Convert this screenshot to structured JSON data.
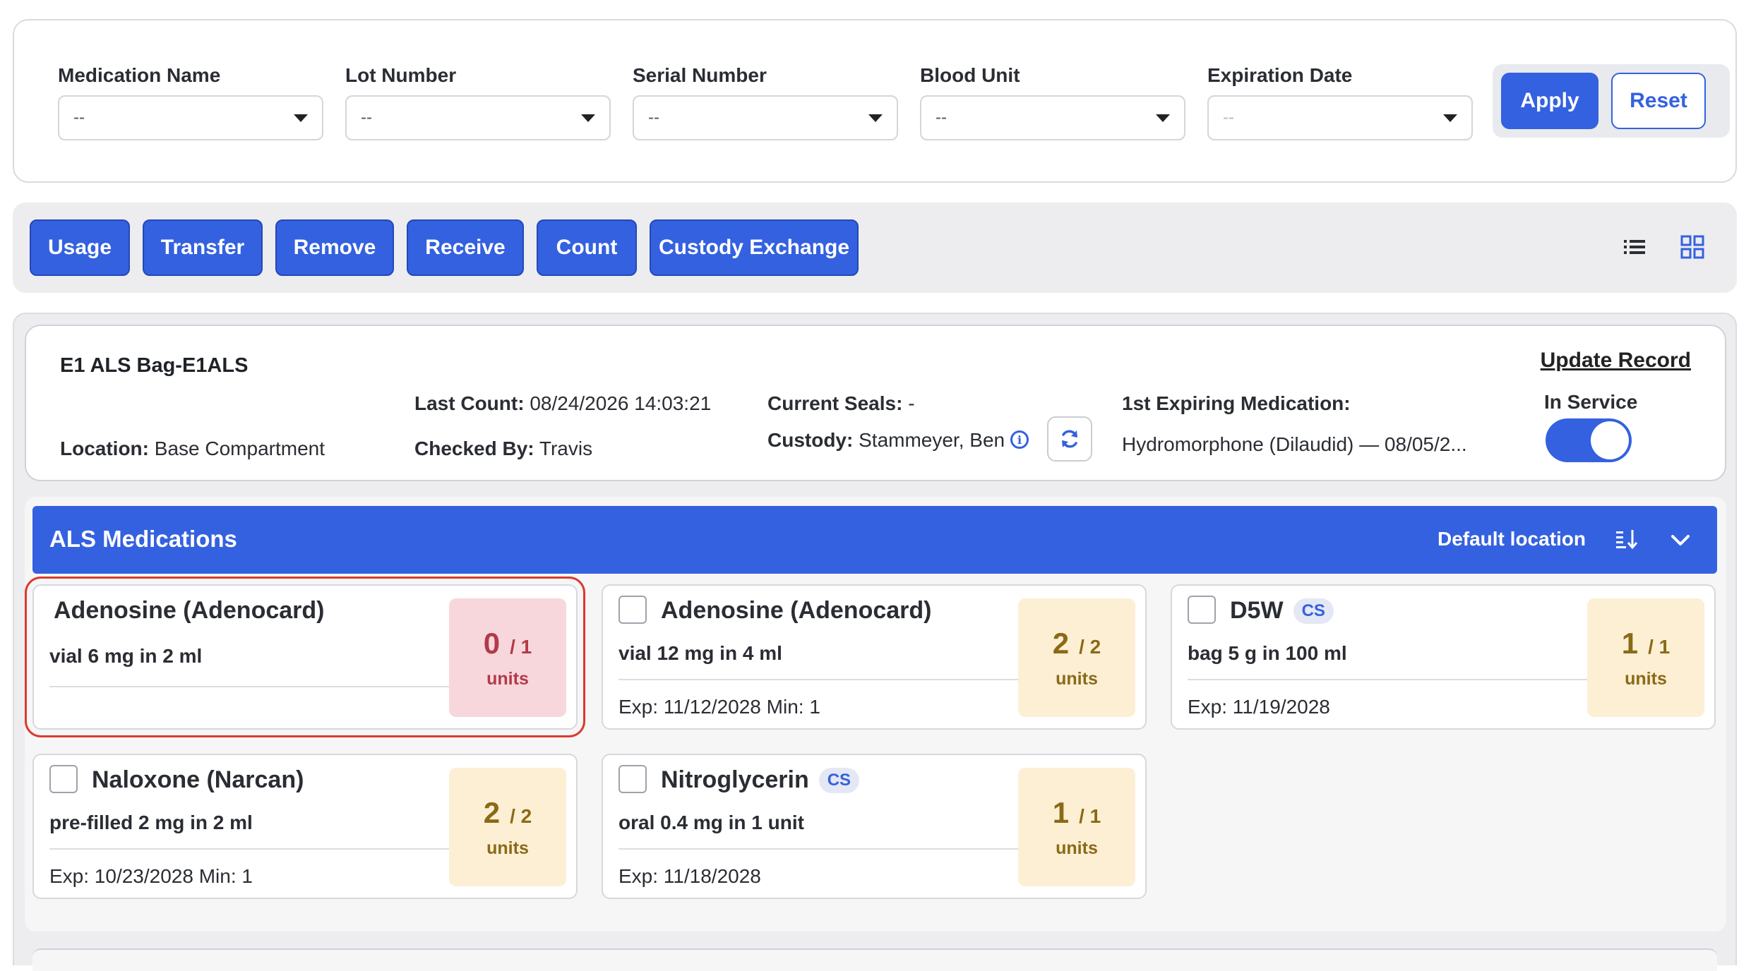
{
  "filters": [
    {
      "label": "Medication Name",
      "value": "--"
    },
    {
      "label": "Lot Number",
      "value": "--"
    },
    {
      "label": "Serial Number",
      "value": "--"
    },
    {
      "label": "Blood Unit",
      "value": "--"
    },
    {
      "label": "Expiration Date",
      "value": "--"
    }
  ],
  "filter_buttons": {
    "apply": "Apply",
    "reset": "Reset"
  },
  "actions": [
    "Usage",
    "Transfer",
    "Remove",
    "Receive",
    "Count",
    "Custody Exchange"
  ],
  "bag": {
    "title": "E1 ALS Bag-E1ALS",
    "location_label": "Location:",
    "location": "Base Compartment",
    "last_count_label": "Last Count:",
    "last_count": "08/24/2026 14:03:21",
    "checked_by_label": "Checked By:",
    "checked_by": "Travis",
    "seals_label": "Current Seals:",
    "seals": "-",
    "custody_label": "Custody:",
    "custody": "Stammeyer, Ben",
    "expiring_label": "1st Expiring Medication:",
    "expiring": "Hydromorphone (Dilaudid) — 08/05/2...",
    "update_record": "Update Record",
    "status_label": "In Service",
    "in_service": true
  },
  "section": {
    "title": "ALS Medications",
    "location": "Default location"
  },
  "medications": [
    {
      "name": "Adenosine (Adenocard)",
      "desc": "vial 6 mg in 2 ml",
      "exp": "",
      "cs": false,
      "qty": "0",
      "total": "/ 1",
      "unit": "units",
      "status": "low",
      "checkbox": false
    },
    {
      "name": "Adenosine (Adenocard)",
      "desc": "vial 12 mg in 4 ml",
      "exp": "Exp: 11/12/2028  Min: 1",
      "cs": false,
      "qty": "2",
      "total": "/ 2",
      "unit": "units",
      "status": "ok",
      "checkbox": true
    },
    {
      "name": "D5W",
      "desc": "bag 5 g in 100 ml",
      "exp": "Exp: 11/19/2028",
      "cs": true,
      "cs_label": "CS",
      "qty": "1",
      "total": "/ 1",
      "unit": "units",
      "status": "ok",
      "checkbox": true
    },
    {
      "name": "Naloxone (Narcan)",
      "desc": "pre-filled 2 mg in 2 ml",
      "exp": "Exp: 10/23/2028  Min: 1",
      "cs": false,
      "qty": "2",
      "total": "/ 2",
      "unit": "units",
      "status": "ok",
      "checkbox": true
    },
    {
      "name": "Nitroglycerin",
      "desc": "oral 0.4 mg in 1 unit",
      "exp": "Exp: 11/18/2028",
      "cs": true,
      "cs_label": "CS",
      "qty": "1",
      "total": "/ 1",
      "unit": "units",
      "status": "ok",
      "checkbox": true
    }
  ],
  "colors": {
    "primary": "#3461e0",
    "low": "#f7d7dc",
    "ok": "#fcefd4",
    "highlight": "#dc3a2c"
  }
}
